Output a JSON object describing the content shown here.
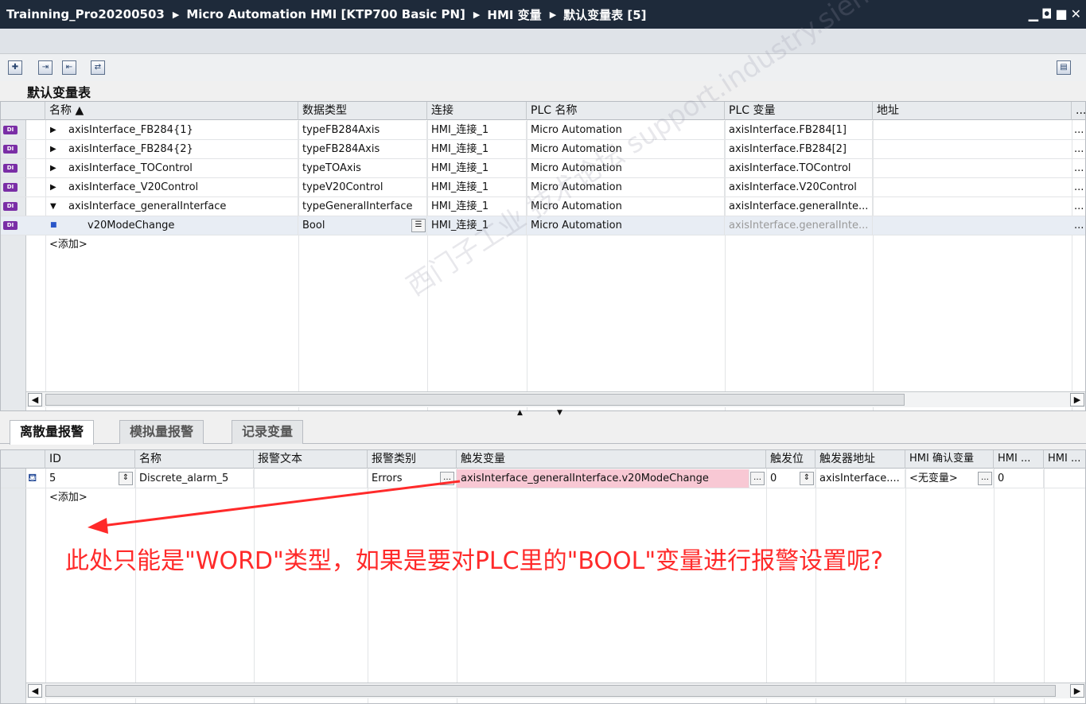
{
  "window": {
    "breadcrumbs": [
      "Trainning_Pro20200503",
      "Micro Automation HMI [KTP700 Basic PN]",
      "HMI 变量",
      "默认变量表 [5]"
    ],
    "controls": [
      "minimize-icon",
      "restore-icon",
      "maximize-icon",
      "close-icon"
    ]
  },
  "tag_table": {
    "title": "默认变量表",
    "columns": [
      "名称 ▲",
      "数据类型",
      "连接",
      "PLC 名称",
      "PLC 变量",
      "地址"
    ],
    "rows": [
      {
        "name": "axisInterface_FB284{1}",
        "type": "typeFB284Axis",
        "conn": "HMI_连接_1",
        "plc": "Micro Automation",
        "plcvar": "axisInterface.FB284[1]"
      },
      {
        "name": "axisInterface_FB284{2}",
        "type": "typeFB284Axis",
        "conn": "HMI_连接_1",
        "plc": "Micro Automation",
        "plcvar": "axisInterface.FB284[2]"
      },
      {
        "name": "axisInterface_TOControl",
        "type": "typeTOAxis",
        "conn": "HMI_连接_1",
        "plc": "Micro Automation",
        "plcvar": "axisInterface.TOControl"
      },
      {
        "name": "axisInterface_V20Control",
        "type": "typeV20Control",
        "conn": "HMI_连接_1",
        "plc": "Micro Automation",
        "plcvar": "axisInterface.V20Control"
      },
      {
        "name": "axisInterface_generalInterface",
        "type": "typeGeneralInterface",
        "conn": "HMI_连接_1",
        "plc": "Micro Automation",
        "plcvar": "axisInterface.generalInte..."
      },
      {
        "name": "v20ModeChange",
        "type": "Bool",
        "conn": "HMI_连接_1",
        "plc": "Micro Automation",
        "plcvar": "axisInterface.generalInte..."
      }
    ],
    "add_label": "<添加>",
    "more": "..."
  },
  "tabs": [
    "离散量报警",
    "模拟量报警",
    "记录变量"
  ],
  "alarm_table": {
    "columns": [
      "ID",
      "名称",
      "报警文本",
      "报警类别",
      "触发变量",
      "触发位",
      "触发器地址",
      "HMI 确认变量",
      "HMI ...",
      "HMI ..."
    ],
    "row": {
      "id": "5",
      "name": "Discrete_alarm_5",
      "text": "",
      "class": "Errors",
      "trigger": "axisInterface_generalInterface.v20ModeChange",
      "bit": "0",
      "addr": "axisInterface....",
      "ack": "<无变量>",
      "hmi": "0"
    },
    "add_label": "<添加>"
  },
  "annotation": "此处只能是\"WORD\"类型，如果是要对PLC里的\"BOOL\"变量进行报警设置呢?",
  "watermark": "西门子工业 技术论坛 support.industry.siemens.com/cs",
  "colors": {
    "title_bg": "#1e2a3a",
    "annotation": "#ff2a2a",
    "trigger_highlight": "#f8c8d4",
    "tag_icon": "#7a2ea6"
  }
}
